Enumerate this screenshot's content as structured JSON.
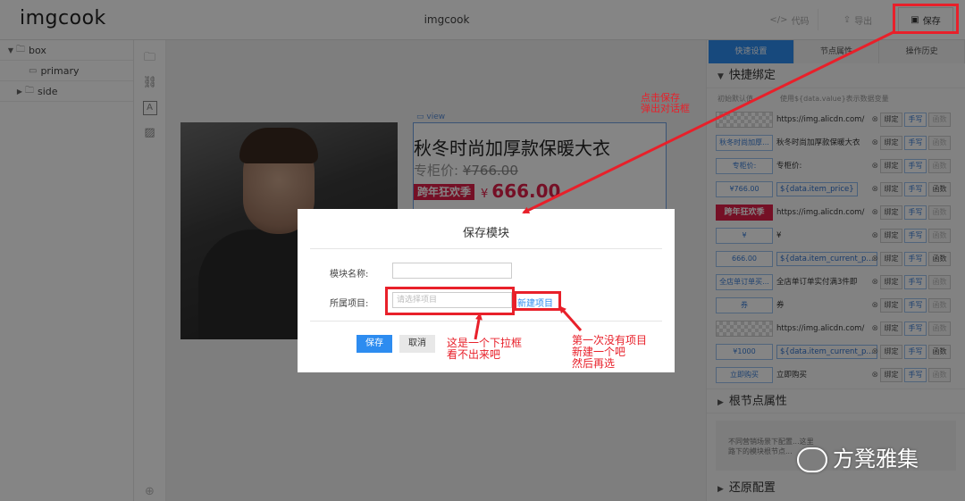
{
  "app": {
    "logo": "imgcook",
    "title": "imgcook"
  },
  "toolbar": {
    "code_label": "代码",
    "export_label": "导出",
    "save_label": "保存"
  },
  "tree": {
    "items": [
      {
        "label": "box",
        "expanded": true
      },
      {
        "label": "primary"
      },
      {
        "label": "side",
        "expanded": false
      }
    ]
  },
  "canvas": {
    "view_label": "view",
    "product_title": "秋冬时尚加厚款保暖大衣",
    "orig_price_label": "专柜价:",
    "orig_price": "¥766.00",
    "promo_badge": "跨年狂欢季",
    "price_symbol": "¥",
    "price": "666.00"
  },
  "panel": {
    "tabs": [
      {
        "label": "快速设置",
        "active": true
      },
      {
        "label": "节点属性",
        "active": false
      },
      {
        "label": "操作历史",
        "active": false
      }
    ],
    "quick_bind_title": "快捷绑定",
    "bind_header": {
      "col1": "初始默认值",
      "col2": "使用${data.value}表示数据变量"
    },
    "rows": [
      {
        "key": "",
        "key_type": "img",
        "value": "https://img.alicdn.com/",
        "chip": false,
        "fn_enabled": false
      },
      {
        "key": "秋冬时尚加厚...",
        "value": "秋冬时尚加厚款保暖大衣",
        "chip": false,
        "fn_enabled": false
      },
      {
        "key": "专柜价:",
        "value": "专柜价:",
        "chip": false,
        "fn_enabled": false
      },
      {
        "key": "¥766.00",
        "value": "${data.item_price}",
        "chip": true,
        "fn_enabled": true
      },
      {
        "key": "跨年狂欢季",
        "key_type": "promo",
        "value": "https://img.alicdn.com/",
        "chip": false,
        "fn_enabled": false
      },
      {
        "key": "¥",
        "value": "¥",
        "chip": false,
        "fn_enabled": false
      },
      {
        "key": "666.00",
        "value": "${data.item_current_p...",
        "chip": true,
        "fn_enabled": true
      },
      {
        "key": "全店单订单买...",
        "value": "全店单订单实付满3件即",
        "chip": false,
        "fn_enabled": false
      },
      {
        "key": "券",
        "value": "券",
        "chip": false,
        "fn_enabled": false
      },
      {
        "key": "",
        "key_type": "img",
        "value": "https://img.alicdn.com/",
        "chip": false,
        "fn_enabled": false
      },
      {
        "key": "¥1000",
        "value": "${data.item_current_p...",
        "chip": true,
        "fn_enabled": true
      },
      {
        "key": "立即购买",
        "value": "立即购买",
        "chip": false,
        "fn_enabled": false
      }
    ],
    "btn_bind": "绑定",
    "btn_manual": "手写",
    "btn_fn": "函数",
    "root_title": "根节点属性",
    "root_note_line1": "不同营销场景下配置...这里",
    "root_note_line2": "路下的模块根节点...",
    "restore_title": "还原配置"
  },
  "dialog": {
    "title": "保存模块",
    "name_label": "模块名称:",
    "name_value": "",
    "project_label": "所属项目:",
    "project_placeholder": "请选择项目",
    "new_project_link": "新建项目",
    "ok_label": "保存",
    "cancel_label": "取消"
  },
  "annotations": {
    "save_note_line1": "点击保存",
    "save_note_line2": "弹出对话框",
    "dropdown_note_line1": "这是一个下拉框",
    "dropdown_note_line2": "看不出来吧",
    "newproj_note_line1": "第一次没有项目",
    "newproj_note_line2": "新建一个吧",
    "newproj_note_line3": "然后再选",
    "accent_color": "#e8202a"
  },
  "watermark": {
    "text": "方凳雅集"
  }
}
